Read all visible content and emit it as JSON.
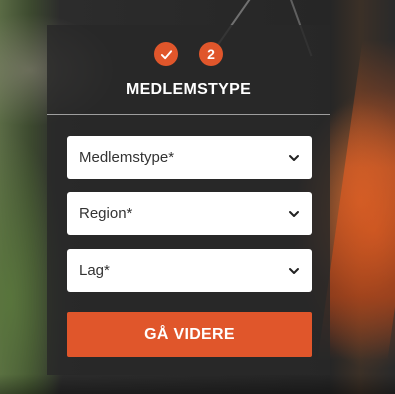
{
  "steps": [
    {
      "state": "done",
      "icon": "check-icon"
    },
    {
      "state": "current",
      "label": "2"
    }
  ],
  "form": {
    "title": "MEDLEMSTYPE",
    "selects": [
      {
        "value": "Medlemstype*",
        "icon": "chevron-down-icon"
      },
      {
        "value": "Region*",
        "icon": "chevron-down-icon"
      },
      {
        "value": "Lag*",
        "icon": "chevron-down-icon"
      }
    ],
    "submit_label": "GÅ VIDERE"
  },
  "colors": {
    "accent": "#e0562b",
    "panel": "#282828",
    "text_light": "#ffffff"
  }
}
